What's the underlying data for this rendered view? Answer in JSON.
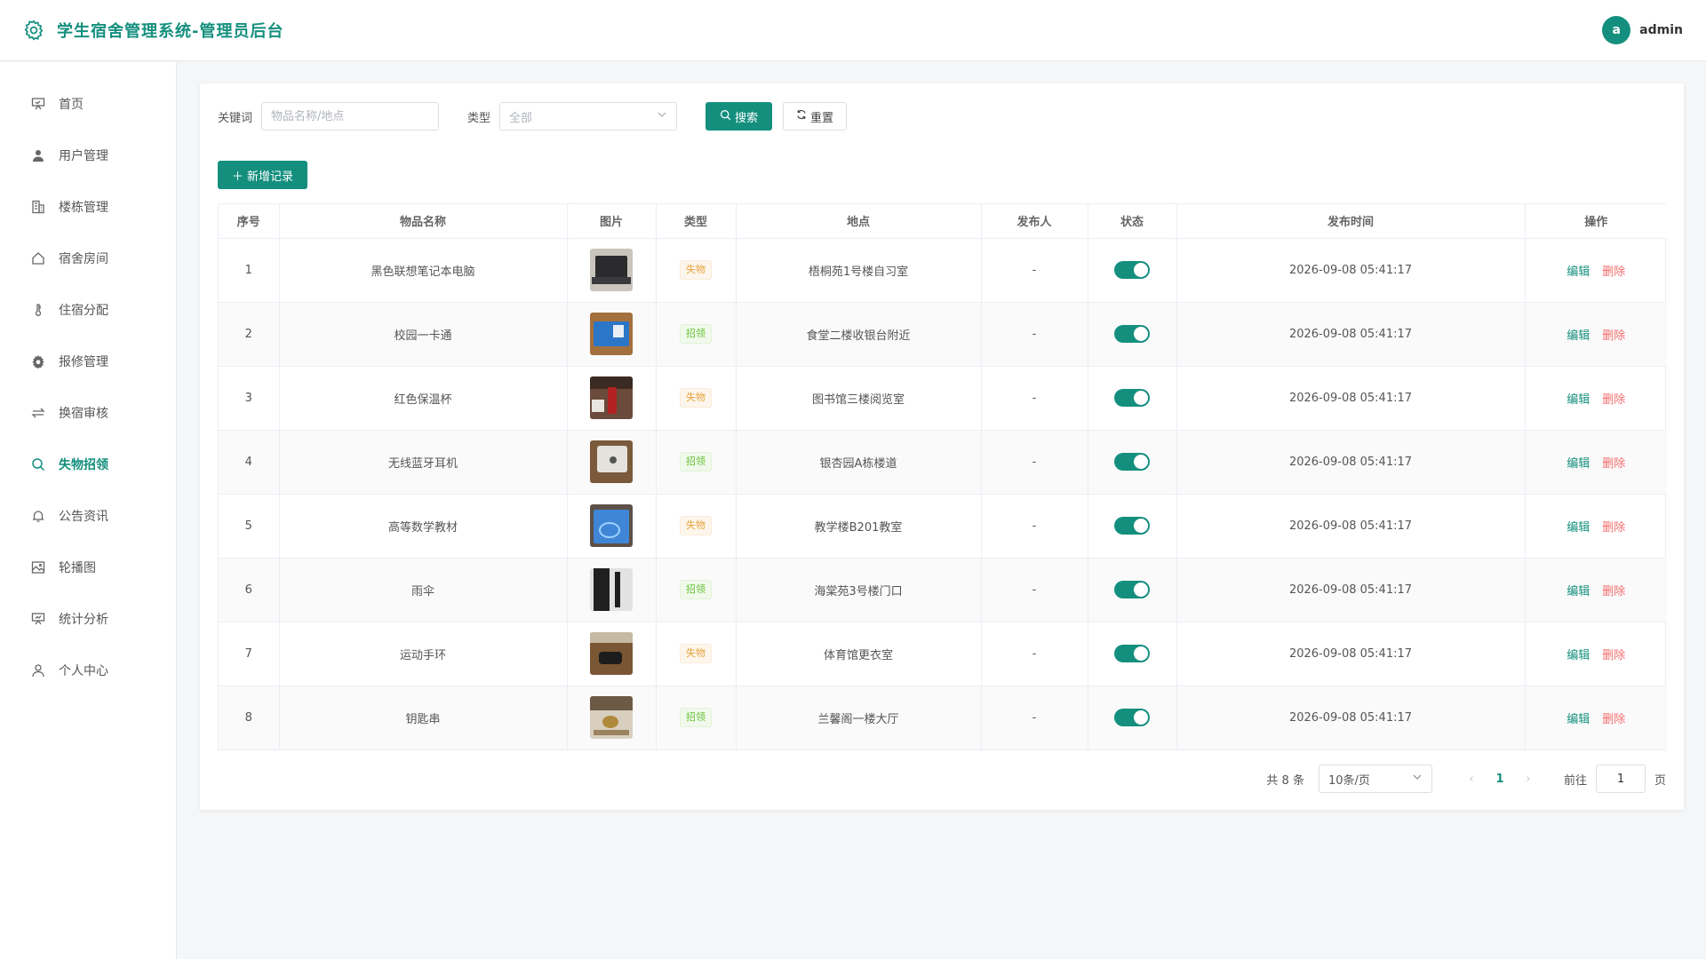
{
  "header": {
    "title": "学生宿舍管理系统-管理员后台",
    "user_initial": "a",
    "user_name": "admin"
  },
  "sidebar": {
    "items": [
      {
        "label": "首页",
        "icon": "presentation-icon"
      },
      {
        "label": "用户管理",
        "icon": "user-icon"
      },
      {
        "label": "楼栋管理",
        "icon": "building-icon"
      },
      {
        "label": "宿舍房间",
        "icon": "home-icon"
      },
      {
        "label": "住宿分配",
        "icon": "thermometer-icon"
      },
      {
        "label": "报修管理",
        "icon": "gear-icon"
      },
      {
        "label": "换宿审核",
        "icon": "swap-icon"
      },
      {
        "label": "失物招领",
        "icon": "search-icon",
        "active": true
      },
      {
        "label": "公告资讯",
        "icon": "bell-icon"
      },
      {
        "label": "轮播图",
        "icon": "picture-icon"
      },
      {
        "label": "统计分析",
        "icon": "chart-board-icon"
      },
      {
        "label": "个人中心",
        "icon": "user-outline-icon"
      }
    ]
  },
  "filters": {
    "keyword_label": "关键词",
    "keyword_placeholder": "物品名称/地点",
    "type_label": "类型",
    "type_value": "全部",
    "search_label": "搜索",
    "reset_label": "重置"
  },
  "add_button": "新增记录",
  "table": {
    "headers": [
      "序号",
      "物品名称",
      "图片",
      "类型",
      "地点",
      "发布人",
      "状态",
      "发布时间",
      "操作"
    ],
    "edit_label": "编辑",
    "delete_label": "删除",
    "rows": [
      {
        "no": "1",
        "name": "黑色联想笔记本电脑",
        "type": "失物",
        "kind": "lost",
        "location": "梧桐苑1号楼自习室",
        "publisher": "-",
        "status": true,
        "time": "2026-09-08 05:41:17",
        "thumb": "laptop"
      },
      {
        "no": "2",
        "name": "校园一卡通",
        "type": "招领",
        "kind": "found",
        "location": "食堂二楼收银台附近",
        "publisher": "-",
        "status": true,
        "time": "2026-09-08 05:41:17",
        "thumb": "card"
      },
      {
        "no": "3",
        "name": "红色保温杯",
        "type": "失物",
        "kind": "lost",
        "location": "图书馆三楼阅览室",
        "publisher": "-",
        "status": true,
        "time": "2026-09-08 05:41:17",
        "thumb": "cup"
      },
      {
        "no": "4",
        "name": "无线蓝牙耳机",
        "type": "招领",
        "kind": "found",
        "location": "银杏园A栋楼道",
        "publisher": "-",
        "status": true,
        "time": "2026-09-08 05:41:17",
        "thumb": "earbuds"
      },
      {
        "no": "5",
        "name": "高等数学教材",
        "type": "失物",
        "kind": "lost",
        "location": "教学楼B201教室",
        "publisher": "-",
        "status": true,
        "time": "2026-09-08 05:41:17",
        "thumb": "book"
      },
      {
        "no": "6",
        "name": "雨伞",
        "type": "招领",
        "kind": "found",
        "location": "海棠苑3号楼门口",
        "publisher": "-",
        "status": true,
        "time": "2026-09-08 05:41:17",
        "thumb": "umbrella"
      },
      {
        "no": "7",
        "name": "运动手环",
        "type": "失物",
        "kind": "lost",
        "location": "体育馆更衣室",
        "publisher": "-",
        "status": true,
        "time": "2026-09-08 05:41:17",
        "thumb": "band"
      },
      {
        "no": "8",
        "name": "钥匙串",
        "type": "招领",
        "kind": "found",
        "location": "兰馨阁一楼大厅",
        "publisher": "-",
        "status": true,
        "time": "2026-09-08 05:41:17",
        "thumb": "keys"
      }
    ]
  },
  "pagination": {
    "total_label": "共 8 条",
    "page_size": "10条/页",
    "current_page": "1",
    "goto_label": "前往",
    "goto_value": "1",
    "page_suffix": "页"
  },
  "colors": {
    "primary": "#148f7e",
    "danger": "#f56c6c",
    "lost_tag": "#e6a23c",
    "found_tag": "#67c23a"
  }
}
